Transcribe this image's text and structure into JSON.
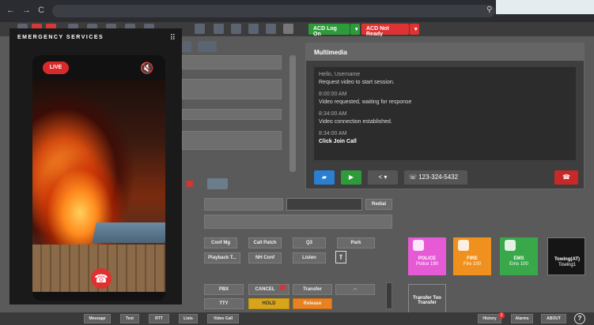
{
  "browser": {
    "nav": "← → C",
    "icons": "⚲ ☆ ● ◆ ★ ☐"
  },
  "toolbar": {
    "acd_on": "ACD Log On",
    "acd_not_ready": "ACD Not Ready",
    "dropdown": "▾"
  },
  "emergency": {
    "title": "EMERGENCY SERVICES",
    "grip": "⠿",
    "live": "LIVE",
    "mute_icon": "🔇",
    "hangup_icon": "☎"
  },
  "multimedia": {
    "title": "Multimedia",
    "messages": [
      {
        "text": "Hello, Username",
        "class": "hello"
      },
      {
        "text": "Request video to start session.",
        "class": ""
      },
      {
        "text": "8:00:00 AM",
        "class": "ts"
      },
      {
        "text": "Video requested, waiting for response",
        "class": ""
      },
      {
        "text": "8:34:00 AM",
        "class": "ts"
      },
      {
        "text": "Video connection established.",
        "class": ""
      },
      {
        "text": "8:34:00 AM",
        "class": "ts"
      },
      {
        "text": "Click Join Call",
        "class": "bold"
      }
    ],
    "phone_number": "123-324-5432"
  },
  "controls": {
    "redial": "Redial",
    "conf_mg": "Conf Mg",
    "call_patch": "Call Patch",
    "q3": "Q3",
    "park": "Park",
    "playback": "Playback T...",
    "nh_conf": "NH Conf",
    "listen": "Listen",
    "pbx": "PBX",
    "cancel": "CANCEL",
    "transfer": "Transfer",
    "tty": "TTY",
    "hold": "HOLD",
    "release": "Release",
    "transfer_to_transfer": "Transfer Too Transfer"
  },
  "tiles": [
    {
      "name": "POLICE",
      "sub": "Police 190",
      "color": "#e65ad6"
    },
    {
      "name": "FIRE",
      "sub": "Fire 100",
      "color": "#f0901e"
    },
    {
      "name": "EMS",
      "sub": "Ems 100",
      "color": "#39a84a"
    },
    {
      "name": "Towing(AT)",
      "sub": "Towing1",
      "color": "#151515"
    }
  ],
  "statusbar": {
    "message": "Message",
    "text": "Text",
    "rtt": "RTT",
    "lists": "Lists",
    "video_call": "Video Call",
    "history": "History",
    "history_badge": "3",
    "alarms": "Alarms",
    "about": "ABOUT",
    "help": "?"
  },
  "colors": {
    "live_red": "#d82a2a",
    "acd_green": "#2e9b3a",
    "acd_red": "#dd3333",
    "hold_yellow": "#d7a51a",
    "release_orange": "#e8811f"
  }
}
